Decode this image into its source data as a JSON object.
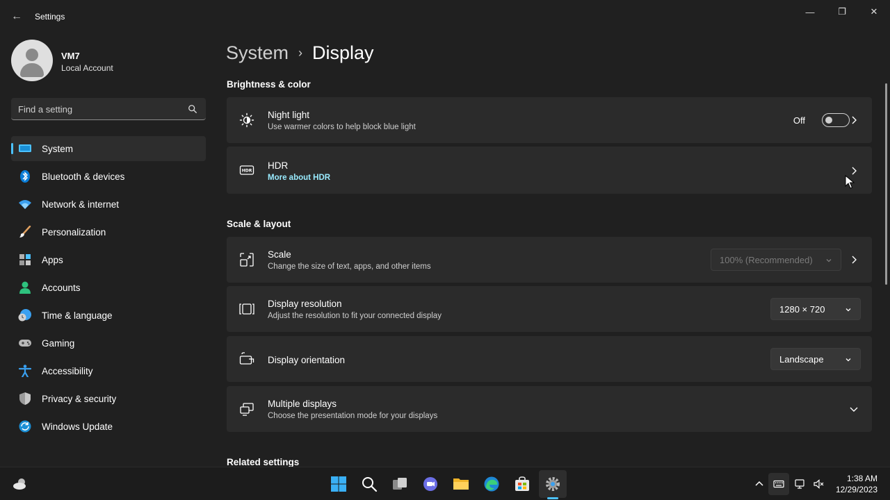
{
  "window": {
    "title": "Settings",
    "minimize": "—",
    "maximize": "❐",
    "close": "✕",
    "back": "←"
  },
  "profile": {
    "name": "VM7",
    "account_type": "Local Account"
  },
  "search": {
    "placeholder": "Find a setting"
  },
  "sidebar": {
    "items": [
      {
        "label": "System",
        "icon": "monitor-icon",
        "active": true
      },
      {
        "label": "Bluetooth & devices",
        "icon": "bluetooth-icon"
      },
      {
        "label": "Network & internet",
        "icon": "wifi-icon"
      },
      {
        "label": "Personalization",
        "icon": "brush-icon"
      },
      {
        "label": "Apps",
        "icon": "apps-icon"
      },
      {
        "label": "Accounts",
        "icon": "person-icon"
      },
      {
        "label": "Time & language",
        "icon": "globe-clock-icon"
      },
      {
        "label": "Gaming",
        "icon": "gamepad-icon"
      },
      {
        "label": "Accessibility",
        "icon": "accessibility-icon"
      },
      {
        "label": "Privacy & security",
        "icon": "shield-icon"
      },
      {
        "label": "Windows Update",
        "icon": "update-icon"
      }
    ]
  },
  "breadcrumb": {
    "parent": "System",
    "separator": "›",
    "current": "Display"
  },
  "sections": {
    "brightness": "Brightness & color",
    "scale_layout": "Scale & layout",
    "related": "Related settings"
  },
  "cards": {
    "night_light": {
      "title": "Night light",
      "subtitle": "Use warmer colors to help block blue light",
      "state_label": "Off"
    },
    "hdr": {
      "title": "HDR",
      "link": "More about HDR"
    },
    "scale": {
      "title": "Scale",
      "subtitle": "Change the size of text, apps, and other items",
      "value": "100% (Recommended)"
    },
    "resolution": {
      "title": "Display resolution",
      "subtitle": "Adjust the resolution to fit your connected display",
      "value": "1280 × 720"
    },
    "orientation": {
      "title": "Display orientation",
      "value": "Landscape"
    },
    "multiple": {
      "title": "Multiple displays",
      "subtitle": "Choose the presentation mode for your displays"
    }
  },
  "taskbar": {
    "time": "1:38 AM",
    "date": "12/29/2023"
  },
  "colors": {
    "accent": "#4cc2ff",
    "link": "#99ebff",
    "background": "#202020",
    "card": "#2b2b2b"
  }
}
